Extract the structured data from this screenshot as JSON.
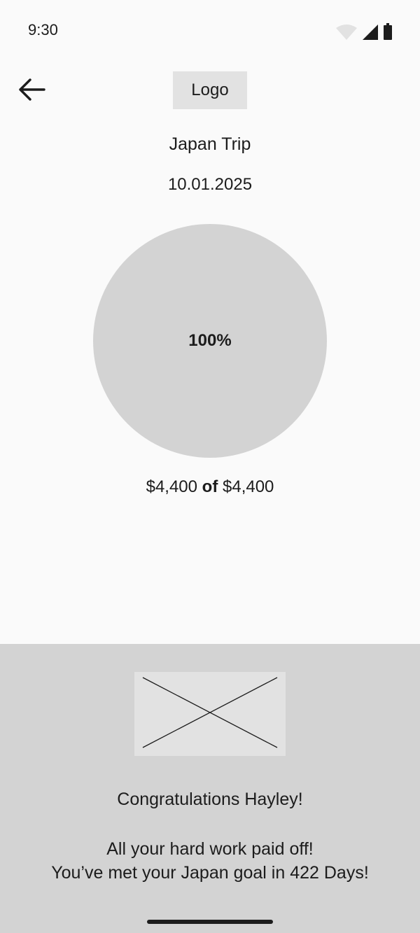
{
  "status_bar": {
    "time": "9:30",
    "icons": [
      "wifi-icon",
      "cellular-signal-icon",
      "battery-icon"
    ]
  },
  "header": {
    "back_icon": "arrow-left-icon",
    "logo_label": "Logo"
  },
  "goal": {
    "title": "Japan Trip",
    "date": "10.01.2025",
    "progress_percent_label": "100%",
    "progress_fraction": 1.0,
    "saved_amount": "$4,400",
    "amount_separator": "of",
    "target_amount": "$4,400"
  },
  "congrats": {
    "image_icon": "image-placeholder-icon",
    "title": "Congratulations Hayley!",
    "line1": "All your hard work paid off!",
    "line2": "You’ve met your Japan goal in 422 Days!"
  },
  "colors": {
    "background": "#fafafa",
    "panel": "#d3d3d3",
    "placeholder": "#e2e2e2",
    "text": "#1c1c1c"
  }
}
